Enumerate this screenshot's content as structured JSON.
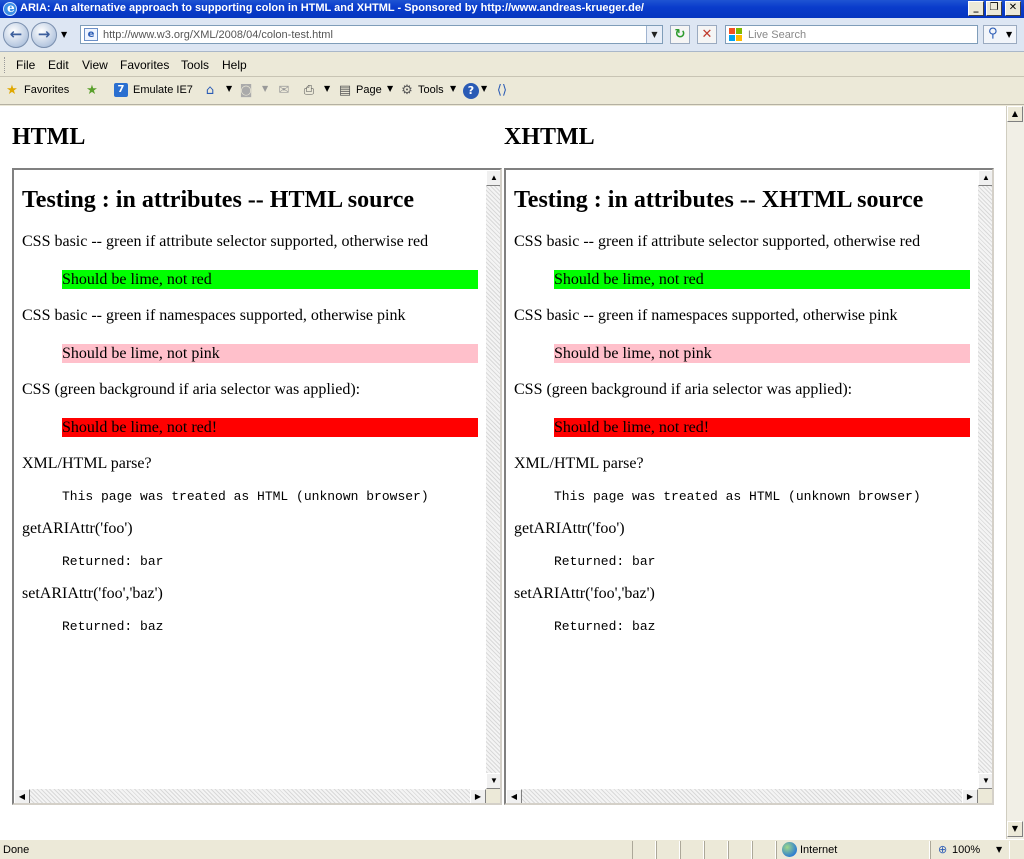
{
  "window": {
    "title": "ARIA: An alternative approach to supporting colon in HTML and XHTML - Sponsored by http://www.andreas-krueger.de/",
    "minimize_glyph": "_",
    "maximize_glyph": "❐",
    "close_glyph": "✕"
  },
  "address_bar": {
    "url": "http://www.w3.org/XML/2008/04/colon-test.html"
  },
  "search": {
    "placeholder": "Live Search"
  },
  "menu": [
    "File",
    "Edit",
    "View",
    "Favorites",
    "Tools",
    "Help"
  ],
  "command_bar": {
    "favorites_label": "Favorites",
    "emulate_label": "Emulate IE7",
    "page_label": "Page",
    "tools_label": "Tools"
  },
  "columns": [
    {
      "heading": "HTML",
      "frame_title": "Testing : in attributes -- HTML source",
      "p1": "CSS basic -- green if attribute selector supported, otherwise red",
      "box1": "Should be lime, not red",
      "p2": "CSS basic -- green if namespaces supported, otherwise pink",
      "box2": "Should be lime, not pink",
      "p3": "CSS (green background if aria selector was applied):",
      "box3": "Should be lime, not red!",
      "p4": "XML/HTML parse?",
      "mono1": "This page was treated as HTML (unknown browser)",
      "p5": "getARIAttr('foo')",
      "mono2": "Returned: bar",
      "p6": "setARIAttr('foo','baz')",
      "mono3": "Returned: baz"
    },
    {
      "heading": "XHTML",
      "frame_title": "Testing : in attributes -- XHTML source",
      "p1": "CSS basic -- green if attribute selector supported, otherwise red",
      "box1": "Should be lime, not red",
      "p2": "CSS basic -- green if namespaces supported, otherwise pink",
      "box2": "Should be lime, not pink",
      "p3": "CSS (green background if aria selector was applied):",
      "box3": "Should be lime, not red!",
      "p4": "XML/HTML parse?",
      "mono1": "This page was treated as HTML (unknown browser)",
      "p5": "getARIAttr('foo')",
      "mono2": "Returned: bar",
      "p6": "setARIAttr('foo','baz')",
      "mono3": "Returned: baz"
    }
  ],
  "colors": {
    "lime": "#00ff00",
    "pink": "#ffc0cb",
    "red": "#ff0000"
  },
  "status_bar": {
    "status": "Done",
    "zone": "Internet",
    "zoom": "100%"
  }
}
